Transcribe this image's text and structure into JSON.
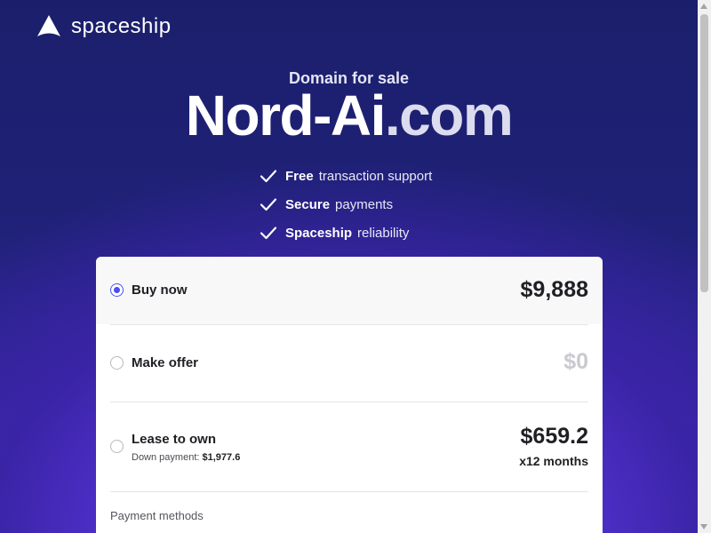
{
  "brand": {
    "name": "spaceship",
    "icon": "spaceship-logo-icon"
  },
  "hero": {
    "kicker": "Domain for sale",
    "domain_name": "Nord-Ai",
    "domain_tld": ".com"
  },
  "features": [
    {
      "strong": "Free",
      "text": "transaction support",
      "icon": "check-icon"
    },
    {
      "strong": "Secure",
      "text": "payments",
      "icon": "check-icon"
    },
    {
      "strong": "Spaceship",
      "text": "reliability",
      "icon": "check-icon"
    }
  ],
  "options": {
    "buy_now": {
      "label": "Buy now",
      "price": "$9,888",
      "selected": true
    },
    "make_offer": {
      "label": "Make offer",
      "price": "$0",
      "selected": false
    },
    "lease": {
      "label": "Lease to own",
      "down_label": "Down payment:",
      "down_value": "$1,977.6",
      "price": "$659.2",
      "term": "x12 months",
      "selected": false
    }
  },
  "payment_methods_label": "Payment methods",
  "colors": {
    "accent": "#4b4ef0",
    "bg_top": "#1b1f6b",
    "bg_glow": "#6a3ff0"
  }
}
